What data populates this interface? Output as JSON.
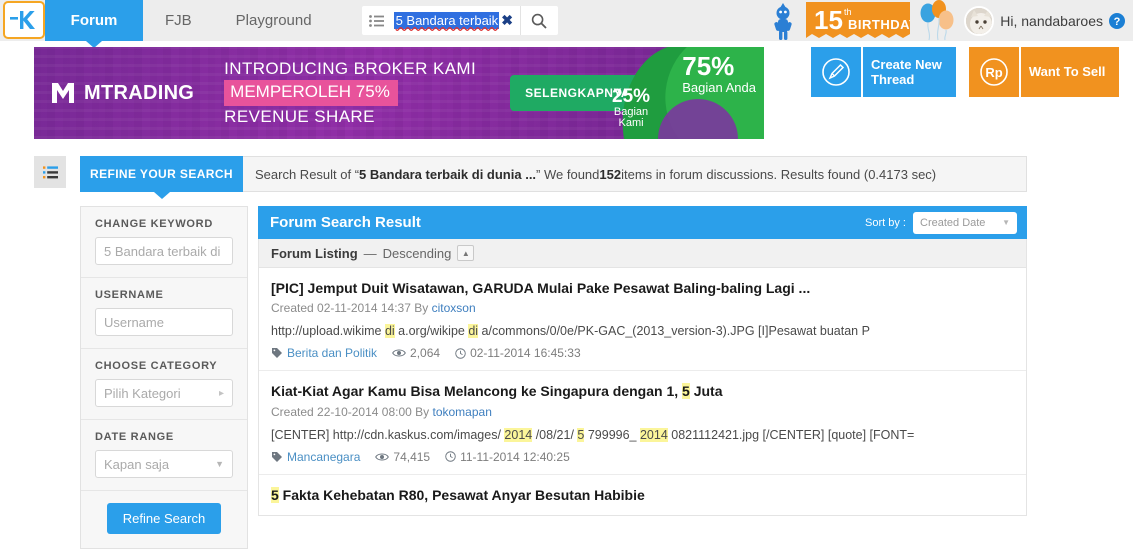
{
  "nav": {
    "logo_name": "kaskus-logo",
    "tabs": [
      {
        "label": "Forum",
        "active": true
      },
      {
        "label": "FJB",
        "active": false
      },
      {
        "label": "Playground",
        "active": false
      }
    ],
    "search": {
      "value": "5 Bandara terbaik",
      "clear_label": "✖",
      "list_icon": "list-icon",
      "search_icon": "search-icon"
    },
    "birthday_number": "15",
    "birthday_sup": "th",
    "birthday_label": "BIRTHDAY",
    "greeting": "Hi, nandabaroes",
    "help_icon": "help-icon"
  },
  "banner": {
    "brand": "MTRADING",
    "line1": "INTRODUCING BROKER KAMI",
    "line2": "MEMPEROLEH 75%",
    "line3": "REVENUE SHARE",
    "cta": "SELENGKAPNYA",
    "donut_major_value": "75%",
    "donut_major_label": "Bagian Anda",
    "donut_minor_value": "25%",
    "donut_minor_label_1": "Bagian",
    "donut_minor_label_2": "Kami",
    "colors": {
      "green": "#1faa63",
      "pink": "#e8539b",
      "purple": "#6c2b8f"
    }
  },
  "actions": [
    {
      "name": "create-new-thread",
      "icon": "pencil-icon",
      "label_line1": "Create New",
      "label_line2": "Thread",
      "color": "#2b9fea"
    },
    {
      "name": "want-to-sell",
      "icon": "rupiah-icon",
      "label_line1": "Want To Sell",
      "label_line2": "",
      "color": "#f1921f"
    }
  ],
  "refine": {
    "tab_label": "REFINE YOUR SEARCH",
    "result_prefix": "Search Result of “",
    "query": "5 Bandara terbaik di dunia ...",
    "result_mid": "” We found ",
    "count": "152",
    "result_suffix": " items in forum discussions. Results found (0.4173 sec)",
    "sidebar_toggle_icon": "list-toggle-icon"
  },
  "filters": {
    "keyword": {
      "label": "CHANGE KEYWORD",
      "placeholder": "5 Bandara terbaik di",
      "value": ""
    },
    "username": {
      "label": "USERNAME",
      "placeholder": "Username",
      "value": ""
    },
    "category": {
      "label": "CHOOSE CATEGORY",
      "placeholder": "Pilih Kategori",
      "value": ""
    },
    "daterange": {
      "label": "DATE RANGE",
      "placeholder": "Kapan saja",
      "value": ""
    },
    "submit_label": "Refine Search"
  },
  "results": {
    "header_title": "Forum Search Result",
    "sort_label": "Sort by :",
    "sort_value": "Created Date",
    "listing_label": "Forum Listing",
    "listing_dash": "—",
    "listing_order": "Descending",
    "items": [
      {
        "title": "[PIC] Jemput Duit Wisatawan, GARUDA Mulai Pake Pesawat Baling-baling Lagi ...",
        "created_label": "Created",
        "created_date": "02-11-2014 14:37",
        "by_label": "By",
        "author": "citoxson",
        "snippet_parts": [
          {
            "t": "http://upload.wikime ",
            "h": false
          },
          {
            "t": "di",
            "h": true
          },
          {
            "t": " a.org/wikipe ",
            "h": false
          },
          {
            "t": "di",
            "h": true
          },
          {
            "t": " a/commons/0/0e/PK-GAC_(2013_version-3).JPG [I]Pesawat buatan P",
            "h": false
          }
        ],
        "category": "Berita dan Politik",
        "views": "2,064",
        "timestamp": "02-11-2014 16:45:33"
      },
      {
        "title": "Kiat-Kiat Agar Kamu Bisa Melancong ke Singapura dengan 1, |5| Juta",
        "title_parts": [
          {
            "t": "Kiat-Kiat Agar Kamu Bisa Melancong ke Singapura dengan 1, ",
            "h": false
          },
          {
            "t": "5",
            "h": true
          },
          {
            "t": " Juta",
            "h": false
          }
        ],
        "created_label": "Created",
        "created_date": "22-10-2014 08:00",
        "by_label": "By",
        "author": "tokomapan",
        "snippet_parts": [
          {
            "t": "[CENTER] http://cdn.kaskus.com/images/ ",
            "h": false
          },
          {
            "t": "2014",
            "h": true
          },
          {
            "t": " /08/21/ ",
            "h": false
          },
          {
            "t": "5",
            "h": true
          },
          {
            "t": " 799996_ ",
            "h": false
          },
          {
            "t": "2014",
            "h": true
          },
          {
            "t": " 0821112421.jpg [/CENTER] [quote] [FONT=",
            "h": false
          }
        ],
        "category": "Mancanegara",
        "views": "74,415",
        "timestamp": "11-11-2014 12:40:25"
      },
      {
        "title_parts": [
          {
            "t": "5",
            "h": true
          },
          {
            "t": " Fakta Kehebatan R80, Pesawat Anyar Besutan Habibie",
            "h": false
          }
        ],
        "created_label": "",
        "created_date": "",
        "by_label": "",
        "author": "",
        "snippet_parts": [],
        "category": "",
        "views": "",
        "timestamp": ""
      }
    ]
  }
}
